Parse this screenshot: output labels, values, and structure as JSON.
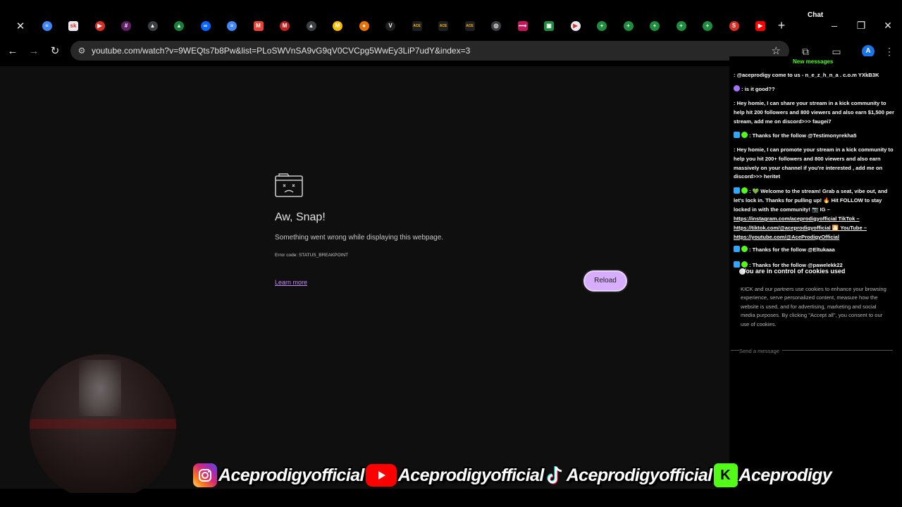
{
  "browser": {
    "tabs": [
      {
        "icon": "close-icon",
        "glyph": "✕",
        "color": "transparent",
        "round": false
      },
      {
        "icon": "docs-icon",
        "glyph": "≡",
        "color": "#4285f4",
        "round": true
      },
      {
        "icon": "sk-icon",
        "glyph": "sk",
        "color": "#e8eaed",
        "round": false
      },
      {
        "icon": "live-icon",
        "glyph": "▶",
        "color": "#d93025",
        "round": true
      },
      {
        "icon": "slack-icon",
        "glyph": "#",
        "color": "#611f69",
        "round": true
      },
      {
        "icon": "triangle-icon",
        "glyph": "▲",
        "color": "#3c4043",
        "round": true
      },
      {
        "icon": "drive-icon",
        "glyph": "▲",
        "color": "#188038",
        "round": true
      },
      {
        "icon": "meta-icon",
        "glyph": "∞",
        "color": "#0866ff",
        "round": true
      },
      {
        "icon": "docs-icon",
        "glyph": "≡",
        "color": "#4285f4",
        "round": true
      },
      {
        "icon": "gmail-icon",
        "glyph": "M",
        "color": "#ea4335",
        "round": false
      },
      {
        "icon": "gmail-icon",
        "glyph": "M",
        "color": "#c5221f",
        "round": true
      },
      {
        "icon": "triangle-icon",
        "glyph": "▲",
        "color": "#3c4043",
        "round": true
      },
      {
        "icon": "coin-icon",
        "glyph": "M",
        "color": "#fbbc04",
        "round": true
      },
      {
        "icon": "circle-icon",
        "glyph": "●",
        "color": "#e8710a",
        "round": true
      },
      {
        "icon": "v-icon",
        "glyph": "V",
        "color": "#1f1f1f",
        "round": true
      },
      {
        "icon": "ace-icon",
        "glyph": "ACE",
        "color": "#1f1f1f",
        "round": false
      },
      {
        "icon": "ace-icon",
        "glyph": "ACE",
        "color": "#1f1f1f",
        "round": false
      },
      {
        "icon": "ace-icon",
        "glyph": "ACE",
        "color": "#1f1f1f",
        "round": false
      },
      {
        "icon": "globe-icon",
        "glyph": "◎",
        "color": "#3c4043",
        "round": true
      },
      {
        "icon": "link-icon",
        "glyph": "⟿",
        "color": "#c2185b",
        "round": false
      },
      {
        "icon": "square-icon",
        "glyph": "▣",
        "color": "#1e8e3e",
        "round": false
      },
      {
        "icon": "play-icon",
        "glyph": "▶",
        "color": "#e8eaed",
        "round": true
      },
      {
        "icon": "plus-circle-icon",
        "glyph": "+",
        "color": "#1e8e3e",
        "round": true
      },
      {
        "icon": "plus-circle-icon",
        "glyph": "+",
        "color": "#1e8e3e",
        "round": true
      },
      {
        "icon": "plus-circle-icon",
        "glyph": "+",
        "color": "#1e8e3e",
        "round": true
      },
      {
        "icon": "plus-circle-icon",
        "glyph": "+",
        "color": "#1e8e3e",
        "round": true
      },
      {
        "icon": "plus-circle-icon",
        "glyph": "+",
        "color": "#1e8e3e",
        "round": true
      },
      {
        "icon": "s-icon",
        "glyph": "S",
        "color": "#d93025",
        "round": true
      },
      {
        "icon": "youtube-icon",
        "glyph": "▶",
        "color": "#ff0000",
        "round": false
      }
    ],
    "new_tab_glyph": "+",
    "chat_label": "Chat",
    "url": "youtube.com/watch?v=9WEQts7b8Pw&list=PLoSWVnSA9vG9qV0CVCpg5WwEy3LiP7udY&index=3"
  },
  "error_page": {
    "title": "Aw, Snap!",
    "message": "Something went wrong while displaying this webpage.",
    "error_code": "Error code: STATUS_BREAKPOINT",
    "learn_more": "Learn more",
    "reload": "Reload"
  },
  "chat": {
    "new_messages": "New messages",
    "messages": [
      {
        "badges": [],
        "text": ": @aceprodigy come to us - n_e_z_h_n_a . c.o.m YXkB3K"
      },
      {
        "badges": [
          "purple"
        ],
        "text": ": is it good??"
      },
      {
        "badges": [],
        "text": ": Hey homie, I can share your stream in a kick community to help hit 200 followers and 800 viewers and also earn $1,500 per stream, add me on discord>>> faugei7"
      },
      {
        "badges": [
          "blue",
          "green"
        ],
        "text": ": Thanks for the follow @Testimonyrekha5"
      },
      {
        "badges": [],
        "text": ": Hey homie, I can promote your stream in a kick community to help you hit 200+ followers and 800 viewers and also earn massively on your channel if you're interested , add me on discord>>> heritet"
      },
      {
        "badges": [
          "blue",
          "green"
        ],
        "text": ": 💚 Welcome to the stream! Grab a seat, vibe out, and let's lock in. Thanks for pulling up! 🔥 Hit FOLLOW to stay locked in with the community! 📷 IG –"
      },
      {
        "badges": [],
        "text": "https://instagram.com/aceprodigyofficial   TikTok –"
      },
      {
        "badges": [],
        "text": "https://tiktok.com/@aceprodigyofficial 🎦 YouTube –"
      },
      {
        "badges": [],
        "text": "https://youtube.com/@AceProdigyOfficial"
      },
      {
        "badges": [
          "blue",
          "green"
        ],
        "text": ": Thanks for the follow @Eltukaaa"
      },
      {
        "badges": [
          "blue",
          "green"
        ],
        "text": ": Thanks for the follow @pawelekk22"
      }
    ],
    "cookie_title": "You are in control of cookies used",
    "cookie_body": "KICK and our partners use cookies to enhance your browsing experience, serve personalized content, measure how the website is used, and for advertising, marketing and social media purposes. By clicking \"Accept all\", you consent to our use of cookies.",
    "send_placeholder": "Send a message"
  },
  "socials": {
    "instagram": "Aceprodigyofficial",
    "youtube": "Aceprodigyofficial",
    "tiktok": "Aceprodigyofficial",
    "kick": "Aceprodigy"
  }
}
